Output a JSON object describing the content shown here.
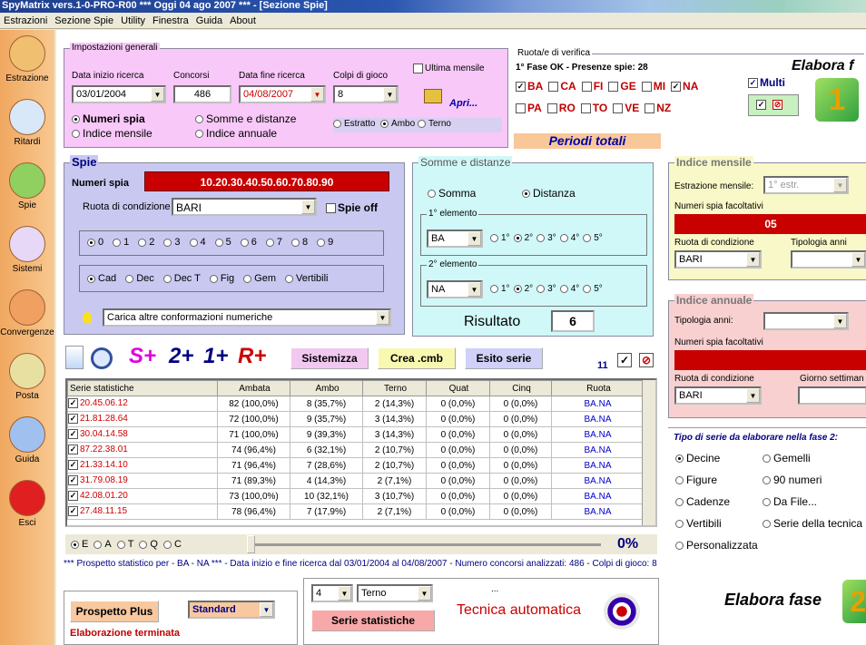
{
  "window": {
    "title": "SpyMatrix vers.1-0-PRO-R00   ***   Oggi 04 ago 2007   ***  - [Sezione Spie]"
  },
  "menu": [
    "Estrazioni",
    "Sezione Spie",
    "Utility",
    "Finestra",
    "Guida",
    "About"
  ],
  "sidebar": [
    {
      "label": "Estrazione",
      "icon": "pencil-icon"
    },
    {
      "label": "Ritardi",
      "icon": "clock-icon"
    },
    {
      "label": "Spie",
      "icon": "binoculars-icon"
    },
    {
      "label": "Sistemi",
      "icon": "bulb-icon"
    },
    {
      "label": "Convergenze",
      "icon": "network-icon"
    },
    {
      "label": "Posta",
      "icon": "coin-icon"
    },
    {
      "label": "Guida",
      "icon": "book-icon"
    },
    {
      "label": "Esci",
      "icon": "power-icon"
    }
  ],
  "impostazioni": {
    "legend": "Impostazioni generali",
    "data_inizio_label": "Data inizio ricerca",
    "data_inizio": "03/01/2004",
    "concorsi_label": "Concorsi",
    "concorsi": "486",
    "data_fine_label": "Data fine ricerca",
    "data_fine": "04/08/2007",
    "colpi_label": "Colpi di gioco",
    "colpi": "8",
    "ultima_mensile": "Ultima mensile",
    "apri": "Apri...",
    "numeri_spia": "Numeri spia",
    "indice_mensile": "Indice mensile",
    "somme_distanze": "Somme e distanze",
    "indice_annuale": "Indice annuale",
    "estratto": "Estratto",
    "ambo": "Ambo",
    "terno": "Terno"
  },
  "ruota": {
    "legend": "Ruota/e di verifica",
    "fase_text": "1° Fase OK - Presenze spie: 28",
    "wheels_row1": [
      {
        "l": "BA",
        "c": true
      },
      {
        "l": "CA",
        "c": false
      },
      {
        "l": "FI",
        "c": false
      },
      {
        "l": "GE",
        "c": false
      },
      {
        "l": "MI",
        "c": false
      },
      {
        "l": "NA",
        "c": true
      }
    ],
    "wheels_row2": [
      {
        "l": "PA",
        "c": false
      },
      {
        "l": "RO",
        "c": false
      },
      {
        "l": "TO",
        "c": false
      },
      {
        "l": "VE",
        "c": false
      },
      {
        "l": "NZ",
        "c": false
      }
    ],
    "multi": "Multi",
    "elabora": "Elabora f",
    "periodi": "Periodi totali"
  },
  "spie": {
    "legend": "Spie",
    "numeri_label": "Numeri spia",
    "numeri": "10.20.30.40.50.60.70.80.90",
    "ruota_label": "Ruota di condizione",
    "ruota": "BARI",
    "spie_off": "Spie off",
    "digits": [
      "0",
      "1",
      "2",
      "3",
      "4",
      "5",
      "6",
      "7",
      "8",
      "9"
    ],
    "types": [
      "Cad",
      "Dec",
      "Dec T",
      "Fig",
      "Gem",
      "Vertibili"
    ],
    "carica": "Carica altre conformazioni numeriche"
  },
  "somme": {
    "legend": "Somme e distanze",
    "somma": "Somma",
    "distanza": "Distanza",
    "el1": "1° elemento",
    "el1_val": "BA",
    "el2": "2° elemento",
    "el2_val": "NA",
    "pos": [
      "1°",
      "2°",
      "3°",
      "4°",
      "5°"
    ],
    "risultato_label": "Risultato",
    "risultato": "6"
  },
  "mensile": {
    "legend": "Indice mensile",
    "estr_label": "Estrazione mensile:",
    "estr_val": "1° estr.",
    "facolt": "Numeri spia facoltativi",
    "num": "05",
    "ruota_label": "Ruota di condizione",
    "ruota": "BARI",
    "tip": "Tipologia anni"
  },
  "annuale": {
    "legend": "Indice annuale",
    "tip": "Tipologia anni:",
    "facolt": "Numeri spia facoltativi",
    "ruota_label": "Ruota di condizione",
    "ruota": "BARI",
    "giorno": "Giorno settiman"
  },
  "toolbar": {
    "splus": "S+",
    "n2": "2+",
    "n1": "1+",
    "rplus": "R+",
    "sistemizza": "Sistemizza",
    "crea": "Crea .cmb",
    "esito": "Esito serie",
    "count": "11"
  },
  "table": {
    "headers": [
      "Serie statistiche",
      "Ambata",
      "Ambo",
      "Terno",
      "Quat",
      "Cinq",
      "Ruota"
    ],
    "rows": [
      [
        "20.45.06.12",
        "82 (100,0%)",
        "8 (35,7%)",
        "2 (14,3%)",
        "0 (0,0%)",
        "0 (0,0%)",
        "BA.NA"
      ],
      [
        "21.81.28.64",
        "72 (100,0%)",
        "9 (35,7%)",
        "3 (14,3%)",
        "0 (0,0%)",
        "0 (0,0%)",
        "BA.NA"
      ],
      [
        "30.04.14.58",
        "71 (100,0%)",
        "9 (39,3%)",
        "3 (14,3%)",
        "0 (0,0%)",
        "0 (0,0%)",
        "BA.NA"
      ],
      [
        "87.22.38.01",
        "74 (96,4%)",
        "6 (32,1%)",
        "2 (10,7%)",
        "0 (0,0%)",
        "0 (0,0%)",
        "BA.NA"
      ],
      [
        "21.33.14.10",
        "71 (96,4%)",
        "7 (28,6%)",
        "2 (10,7%)",
        "0 (0,0%)",
        "0 (0,0%)",
        "BA.NA"
      ],
      [
        "31.79.08.19",
        "71 (89,3%)",
        "4 (14,3%)",
        "2 (7,1%)",
        "0 (0,0%)",
        "0 (0,0%)",
        "BA.NA"
      ],
      [
        "42.08.01.20",
        "73 (100,0%)",
        "10 (32,1%)",
        "3 (10,7%)",
        "0 (0,0%)",
        "0 (0,0%)",
        "BA.NA"
      ],
      [
        "27.48.11.15",
        "78 (96,4%)",
        "7 (17,9%)",
        "2 (7,1%)",
        "0 (0,0%)",
        "0 (0,0%)",
        "BA.NA"
      ]
    ]
  },
  "progress": {
    "letters": [
      "E",
      "A",
      "T",
      "Q",
      "C"
    ],
    "pct": "0%"
  },
  "prospetto": {
    "text": "*** Prospetto statistico per  - BA - NA ***  - Data inizio e fine ricerca dal 03/01/2004 al 04/08/2007 - Numero concorsi analizzati: 486 - Colpi di gioco: 8",
    "plus": "Prospetto Plus",
    "standard": "Standard",
    "status": "Elaborazione terminata"
  },
  "tecnica": {
    "n": "4",
    "tipo": "Terno",
    "serie": "Serie statistiche",
    "title": "Tecnica automatica",
    "dots": "..."
  },
  "tipo_serie": {
    "legend": "Tipo di serie da elaborare nella fase 2:",
    "opts": [
      "Decine",
      "Gemelli",
      "Figure",
      "90 numeri",
      "Cadenze",
      "Da File...",
      "Vertibili",
      "Serie della tecnica",
      "Personalizzata"
    ],
    "elabora": "Elabora fase"
  }
}
